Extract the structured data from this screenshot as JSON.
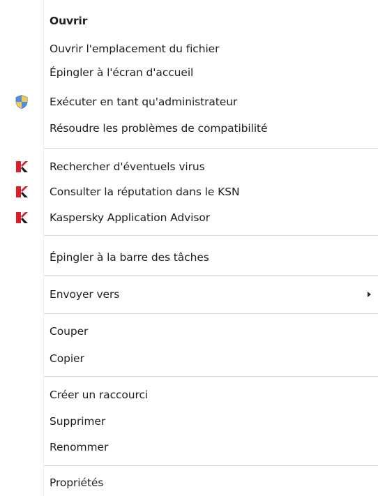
{
  "context_menu": {
    "items": [
      {
        "label": "Ouvrir",
        "icon": null
      },
      {
        "label": "Ouvrir l'emplacement du fichier",
        "icon": null
      },
      {
        "label": "Épingler à l'écran d'accueil",
        "icon": null
      },
      {
        "label": "Exécuter en tant qu'administrateur",
        "icon": "uac-shield-icon"
      },
      {
        "label": "Résoudre les problèmes de compatibilité",
        "icon": null
      },
      {
        "label": "Rechercher d'éventuels virus",
        "icon": "kaspersky-icon"
      },
      {
        "label": "Consulter la réputation dans le KSN",
        "icon": "kaspersky-icon"
      },
      {
        "label": "Kaspersky Application Advisor",
        "icon": "kaspersky-icon"
      },
      {
        "label": "Épingler à la barre des tâches",
        "icon": null
      },
      {
        "label": "Envoyer vers",
        "icon": null,
        "submenu": true
      },
      {
        "label": "Couper",
        "icon": null
      },
      {
        "label": "Copier",
        "icon": null
      },
      {
        "label": "Créer un raccourci",
        "icon": null
      },
      {
        "label": "Supprimer",
        "icon": null
      },
      {
        "label": "Renommer",
        "icon": null
      },
      {
        "label": "Propriétés",
        "icon": null
      }
    ]
  },
  "colors": {
    "text": "#1e1e1e",
    "separator": "#d7d7d7",
    "kaspersky_red": "#d9202b",
    "shield_blue": "#2e6fd1",
    "shield_yellow": "#f2c94c"
  }
}
